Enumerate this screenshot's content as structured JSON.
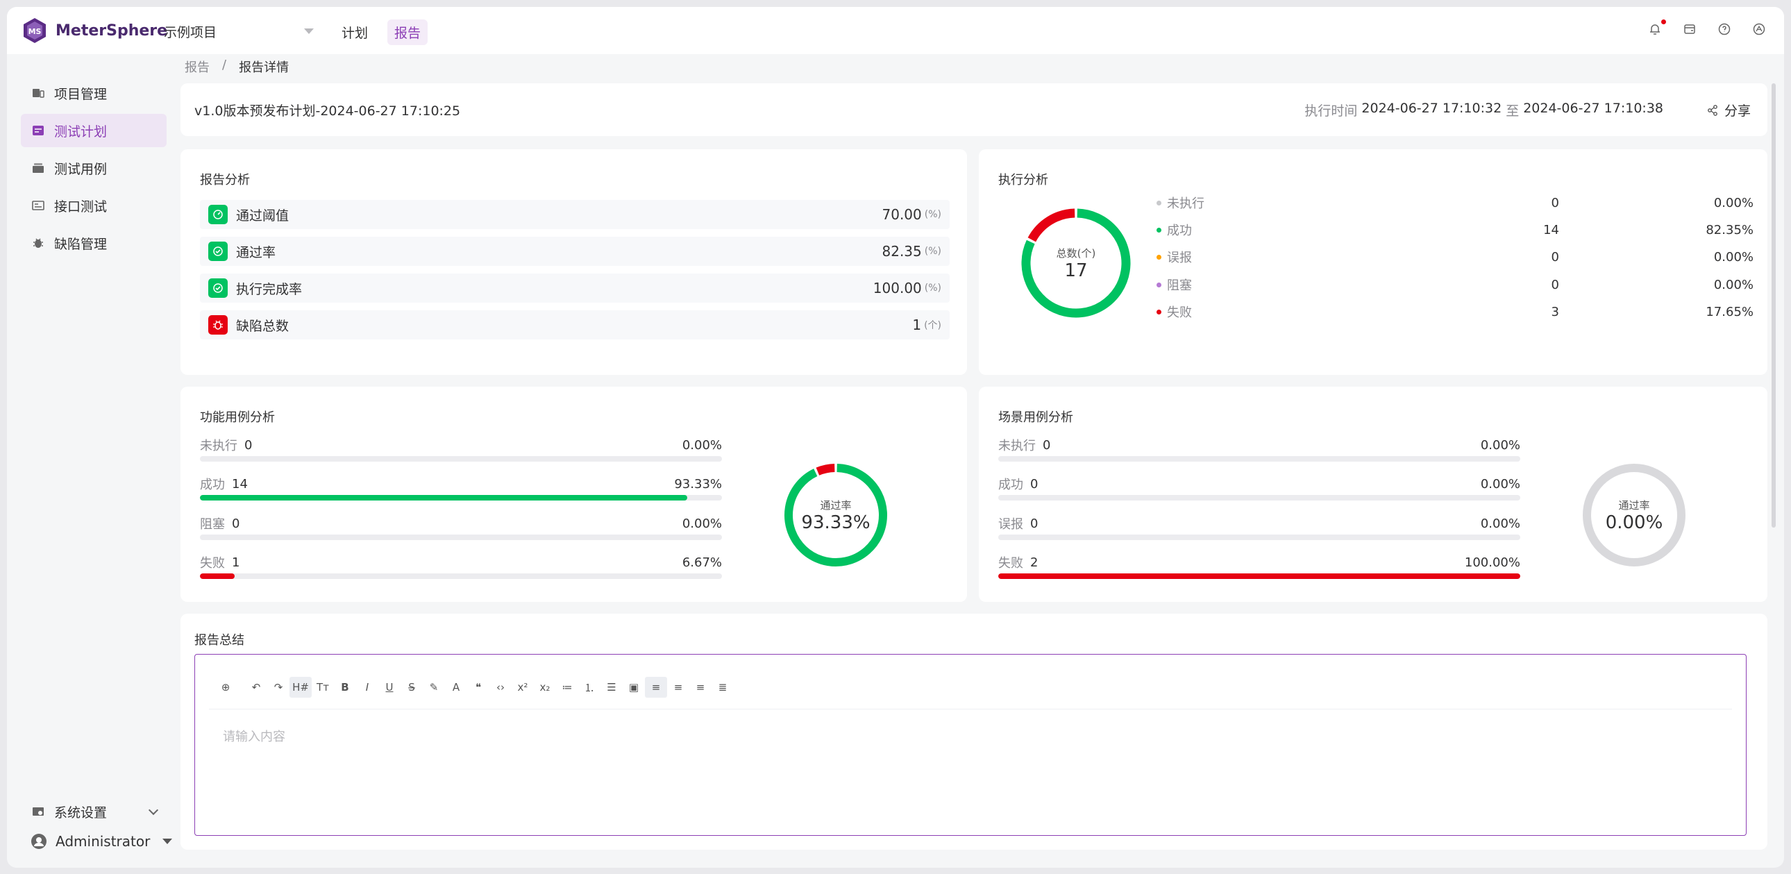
{
  "app": {
    "name": "MeterSphere",
    "project": "示例项目",
    "nav": [
      {
        "label": "计划",
        "active": false
      },
      {
        "label": "报告",
        "active": true
      }
    ],
    "accent_color": "#8c3fb5"
  },
  "sidebar": {
    "items": [
      {
        "label": "项目管理",
        "icon": "project-icon",
        "active": false
      },
      {
        "label": "测试计划",
        "icon": "test-plan-icon",
        "active": true
      },
      {
        "label": "测试用例",
        "icon": "test-case-icon",
        "active": false
      },
      {
        "label": "接口测试",
        "icon": "api-test-icon",
        "active": false
      },
      {
        "label": "缺陷管理",
        "icon": "bug-icon",
        "active": false
      }
    ],
    "system_settings": "系统设置",
    "user": "Administrator"
  },
  "breadcrumb": [
    "报告",
    "报告详情"
  ],
  "report": {
    "title": "v1.0版本预发布计划-2024-06-27 17:10:25",
    "exec_time_label": "执行时间",
    "start": "2024-06-27 17:10:32",
    "to": "至",
    "end": "2024-06-27 17:10:38",
    "share_label": "分享"
  },
  "report_analysis": {
    "title": "报告分析",
    "rows": [
      {
        "label": "通过阈值",
        "value": "70.00",
        "unit": "(%)",
        "icon": "threshold-icon",
        "color": "green"
      },
      {
        "label": "通过率",
        "value": "82.35",
        "unit": "(%)",
        "icon": "check-circle-icon",
        "color": "green"
      },
      {
        "label": "执行完成率",
        "value": "100.00",
        "unit": "(%)",
        "icon": "check-circle-icon",
        "color": "green"
      },
      {
        "label": "缺陷总数",
        "value": "1",
        "unit": "(个)",
        "icon": "bug-icon",
        "color": "red"
      }
    ]
  },
  "execution_analysis": {
    "title": "执行分析",
    "center_label": "总数(个)",
    "total": "17",
    "legend": [
      {
        "name": "未执行",
        "count": "0",
        "pct": "0.00%",
        "color": "#c8c9cc",
        "value": 0
      },
      {
        "name": "成功",
        "count": "14",
        "pct": "82.35%",
        "color": "#00c261",
        "value": 14
      },
      {
        "name": "误报",
        "count": "0",
        "pct": "0.00%",
        "color": "#ffa200",
        "value": 0
      },
      {
        "name": "阻塞",
        "count": "0",
        "pct": "0.00%",
        "color": "#b57ad4",
        "value": 0
      },
      {
        "name": "失败",
        "count": "3",
        "pct": "17.65%",
        "color": "#e60012",
        "value": 3
      }
    ]
  },
  "function_analysis": {
    "title": "功能用例分析",
    "rate_label": "通过率",
    "rate": "93.33%",
    "rows": [
      {
        "name": "未执行",
        "count": "0",
        "pct": "0.00%",
        "value": 0.0,
        "color": "#c8c9cc"
      },
      {
        "name": "成功",
        "count": "14",
        "pct": "93.33%",
        "value": 0.9333,
        "color": "#00c261"
      },
      {
        "name": "阻塞",
        "count": "0",
        "pct": "0.00%",
        "value": 0.0,
        "color": "#b57ad4"
      },
      {
        "name": "失败",
        "count": "1",
        "pct": "6.67%",
        "value": 0.0667,
        "color": "#e60012"
      }
    ]
  },
  "scenario_analysis": {
    "title": "场景用例分析",
    "rate_label": "通过率",
    "rate": "0.00%",
    "rows": [
      {
        "name": "未执行",
        "count": "0",
        "pct": "0.00%",
        "value": 0.0,
        "color": "#c8c9cc"
      },
      {
        "name": "成功",
        "count": "0",
        "pct": "0.00%",
        "value": 0.0,
        "color": "#00c261"
      },
      {
        "name": "误报",
        "count": "0",
        "pct": "0.00%",
        "value": 0.0,
        "color": "#ffa200"
      },
      {
        "name": "失败",
        "count": "2",
        "pct": "100.00%",
        "value": 1.0,
        "color": "#e60012"
      }
    ]
  },
  "summary": {
    "title": "报告总结",
    "placeholder": "请输入内容",
    "toolbar": [
      "plus-icon",
      "undo-icon",
      "redo-icon",
      "heading-icon",
      "font-size-icon",
      "bold-icon",
      "italic-icon",
      "underline-icon",
      "strikethrough-icon",
      "highlight-icon",
      "font-color-icon",
      "quote-icon",
      "code-icon",
      "superscript-icon",
      "subscript-icon",
      "bullet-list-icon",
      "ordered-list-icon",
      "task-list-icon",
      "code-block-icon",
      "align-left-icon",
      "align-center-icon",
      "align-right-icon",
      "align-justify-icon"
    ]
  }
}
